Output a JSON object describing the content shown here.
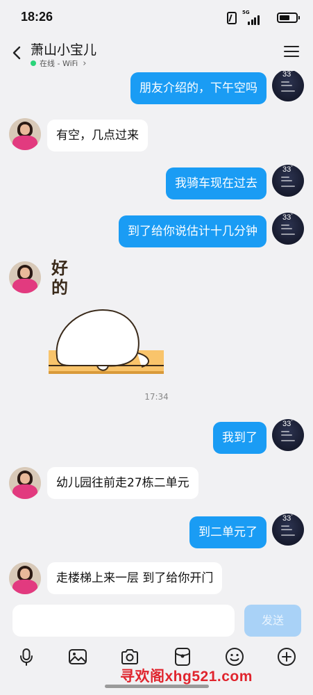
{
  "status_bar": {
    "time": "18:26",
    "network": "5G",
    "icons": [
      "nfc-icon",
      "signal-icon",
      "battery-icon"
    ]
  },
  "header": {
    "contact_name": "萧山小宝儿",
    "online_status": "在线 - WiFi",
    "online_color": "#2ad47a",
    "icons": [
      "back-arrow-icon",
      "chevron-right-icon",
      "menu-icon"
    ]
  },
  "avatar_self": {
    "temperature": "33",
    "degree": "°"
  },
  "messages": [
    {
      "sender": "me",
      "text": "朋友介绍的，下午空吗"
    },
    {
      "sender": "contact",
      "text": "有空，几点过来"
    },
    {
      "sender": "me",
      "text": "我骑车现在过去"
    },
    {
      "sender": "me",
      "text": "到了给你说估计十几分钟"
    },
    {
      "sender": "contact",
      "type": "sticker",
      "text": "好的"
    },
    {
      "type": "timestamp",
      "text": "17:34"
    },
    {
      "sender": "me",
      "text": "我到了"
    },
    {
      "sender": "contact",
      "text": "幼儿园往前走27栋二单元"
    },
    {
      "sender": "me",
      "text": "到二单元了"
    },
    {
      "sender": "contact",
      "text": "走楼梯上来一层 到了给你开门"
    }
  ],
  "input": {
    "placeholder": "",
    "send_label": "发送"
  },
  "toolbar": {
    "icons": [
      "microphone-icon",
      "image-icon",
      "camera-icon",
      "red-packet-icon",
      "emoji-icon",
      "plus-icon"
    ]
  },
  "colors": {
    "outgoing_bubble": "#1a9cf4",
    "incoming_bubble": "#ffffff",
    "background": "#f1f1f3",
    "send_button_disabled": "#a9d2f7",
    "watermark": "#e0242d"
  },
  "watermark": "寻欢阁xhg521.com"
}
